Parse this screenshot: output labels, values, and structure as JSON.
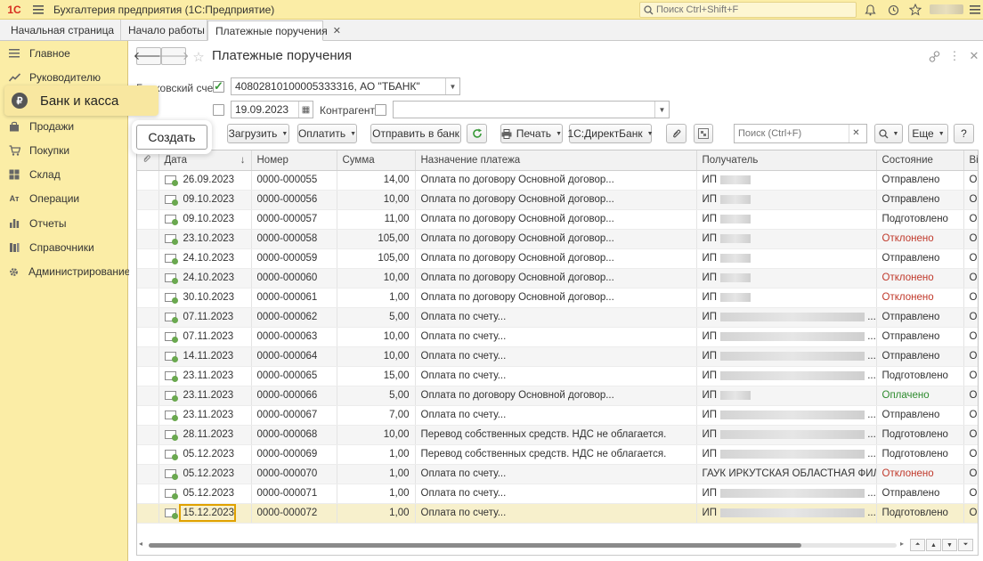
{
  "topbar": {
    "logo": "1С",
    "app_title": "Бухгалтерия предприятия  (1С:Предприятие)",
    "search_placeholder": "Поиск Ctrl+Shift+F"
  },
  "tabs": [
    {
      "label": "Начальная страница"
    },
    {
      "label": "Начало работы"
    },
    {
      "label": "Платежные поручения"
    }
  ],
  "sidebar": {
    "items": [
      {
        "label": "Главное",
        "icon": "menu-icon"
      },
      {
        "label": "Руководителю",
        "icon": "trend-icon"
      },
      {
        "label": "Банк и касса",
        "icon": "ruble-icon"
      },
      {
        "label": "Продажи",
        "icon": "bag-icon"
      },
      {
        "label": "Покупки",
        "icon": "cart-icon"
      },
      {
        "label": "Склад",
        "icon": "warehouse-icon"
      },
      {
        "label": "Операции",
        "icon": "operations-icon"
      },
      {
        "label": "Отчеты",
        "icon": "bar-chart-icon"
      },
      {
        "label": "Справочники",
        "icon": "books-icon"
      },
      {
        "label": "Администрирование",
        "icon": "gear-icon"
      }
    ],
    "active_label": "Банк и касса"
  },
  "form": {
    "title": "Платежные поручения",
    "account_label": "Банковский счет:",
    "account_value": "40802810100005333316, АО \"ТБАНК\"",
    "date_value": "19.09.2023",
    "counterparty_label": "Контрагент:",
    "counterparty_value": ""
  },
  "toolbar": {
    "create": "Создать",
    "load": "Загрузить",
    "pay": "Оплатить",
    "send_to_bank": "Отправить в банк",
    "print": "Печать",
    "direct_bank": "1С:ДиректБанк",
    "search_placeholder": "Поиск (Ctrl+F)",
    "more": "Еще",
    "help": "?"
  },
  "table": {
    "columns": [
      "Дата",
      "Номер",
      "Сумма",
      "Назначение платежа",
      "Получатель",
      "Состояние",
      "Ві"
    ],
    "rows": [
      {
        "date": "26.09.2023",
        "number": "0000-000055",
        "sum": "14,00",
        "purpose": "Оплата по договору Основной договор...",
        "recipient": "ИП",
        "status": "Отправлено",
        "extra": "Оі"
      },
      {
        "date": "09.10.2023",
        "number": "0000-000056",
        "sum": "10,00",
        "purpose": "Оплата по договору Основной договор...",
        "recipient": "ИП",
        "status": "Отправлено",
        "extra": "Оі"
      },
      {
        "date": "09.10.2023",
        "number": "0000-000057",
        "sum": "11,00",
        "purpose": "Оплата по договору Основной договор...",
        "recipient": "ИП",
        "status": "Подготовлено",
        "extra": "Оі"
      },
      {
        "date": "23.10.2023",
        "number": "0000-000058",
        "sum": "105,00",
        "purpose": "Оплата по договору Основной договор...",
        "recipient": "ИП",
        "status": "Отклонено",
        "extra": "Оі"
      },
      {
        "date": "24.10.2023",
        "number": "0000-000059",
        "sum": "105,00",
        "purpose": "Оплата по договору Основной договор...",
        "recipient": "ИП",
        "status": "Отправлено",
        "extra": "Оі"
      },
      {
        "date": "24.10.2023",
        "number": "0000-000060",
        "sum": "10,00",
        "purpose": "Оплата по договору Основной договор...",
        "recipient": "ИП",
        "status": "Отклонено",
        "extra": "Оі"
      },
      {
        "date": "30.10.2023",
        "number": "0000-000061",
        "sum": "1,00",
        "purpose": "Оплата по договору Основной договор...",
        "recipient": "ИП",
        "status": "Отклонено",
        "extra": "Оі"
      },
      {
        "date": "07.11.2023",
        "number": "0000-000062",
        "sum": "5,00",
        "purpose": "Оплата по счету...",
        "recipient": "ИП",
        "status": "Отправлено",
        "extra": "Оі"
      },
      {
        "date": "07.11.2023",
        "number": "0000-000063",
        "sum": "10,00",
        "purpose": "Оплата по счету...",
        "recipient": "ИП",
        "status": "Отправлено",
        "extra": "Оі"
      },
      {
        "date": "14.11.2023",
        "number": "0000-000064",
        "sum": "10,00",
        "purpose": "Оплата по счету...",
        "recipient": "ИП",
        "status": "Отправлено",
        "extra": "Оі"
      },
      {
        "date": "23.11.2023",
        "number": "0000-000065",
        "sum": "15,00",
        "purpose": "Оплата по счету...",
        "recipient": "ИП",
        "status": "Подготовлено",
        "extra": "Оі"
      },
      {
        "date": "23.11.2023",
        "number": "0000-000066",
        "sum": "5,00",
        "purpose": "Оплата по договору Основной договор...",
        "recipient": "ИП",
        "status": "Оплачено",
        "extra": "Оі"
      },
      {
        "date": "23.11.2023",
        "number": "0000-000067",
        "sum": "7,00",
        "purpose": "Оплата по счету...",
        "recipient": "ИП",
        "status": "Отправлено",
        "extra": "Оі"
      },
      {
        "date": "28.11.2023",
        "number": "0000-000068",
        "sum": "10,00",
        "purpose": "Перевод собственных средств. НДС не облагается.",
        "recipient": "ИП",
        "status": "Подготовлено",
        "extra": "Оі"
      },
      {
        "date": "05.12.2023",
        "number": "0000-000069",
        "sum": "1,00",
        "purpose": "Перевод собственных средств. НДС не облагается.",
        "recipient": "ИП",
        "status": "Подготовлено",
        "extra": "Оі"
      },
      {
        "date": "05.12.2023",
        "number": "0000-000070",
        "sum": "1,00",
        "purpose": "Оплата по счету...",
        "recipient": "ГАУК ИРКУТСКАЯ ОБЛАСТНАЯ ФИЛ...",
        "status": "Отклонено",
        "extra": "Оі"
      },
      {
        "date": "05.12.2023",
        "number": "0000-000071",
        "sum": "1,00",
        "purpose": "Оплата по счету...",
        "recipient": "ИП",
        "status": "Отправлено",
        "extra": "Оі"
      },
      {
        "date": "15.12.2023",
        "number": "0000-000072",
        "sum": "1,00",
        "purpose": "Оплата по счету...",
        "recipient": "ИП",
        "status": "Подготовлено",
        "extra": "Оі"
      }
    ]
  },
  "colors": {
    "sidebar_bg": "#fbeda6",
    "rejected": "#c0392b",
    "paid": "#2e8b2e",
    "selected_row": "#f7f0cc"
  }
}
